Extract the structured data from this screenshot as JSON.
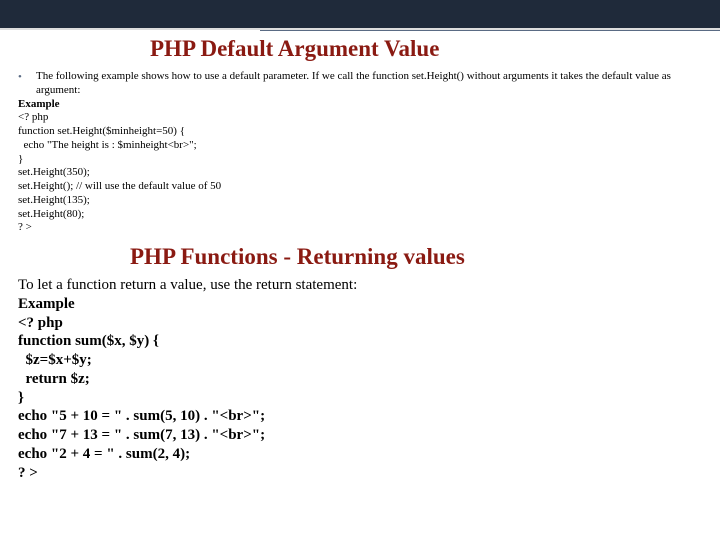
{
  "section1": {
    "title": "PHP Default Argument Value",
    "bullet": "The following example shows how to use a default parameter. If we call the function set.Height() without arguments it takes the default value as argument:",
    "example_label": "Example",
    "code": "<? php\nfunction set.Height($minheight=50) {\n  echo \"The height is : $minheight<br>\";\n}\nset.Height(350);\nset.Height(); // will use the default value of 50\nset.Height(135);\nset.Height(80);\n? >"
  },
  "section2": {
    "title": "PHP Functions - Returning values",
    "intro": "To let a function return a value, use the return statement:",
    "example_label": "Example",
    "code": "<? php\nfunction sum($x, $y) {\n  $z=$x+$y;\n  return $z;\n}\necho \"5 + 10 = \" . sum(5, 10) . \"<br>\";\necho \"7 + 13 = \" . sum(7, 13) . \"<br>\";\necho \"2 + 4 = \" . sum(2, 4);\n? >"
  }
}
